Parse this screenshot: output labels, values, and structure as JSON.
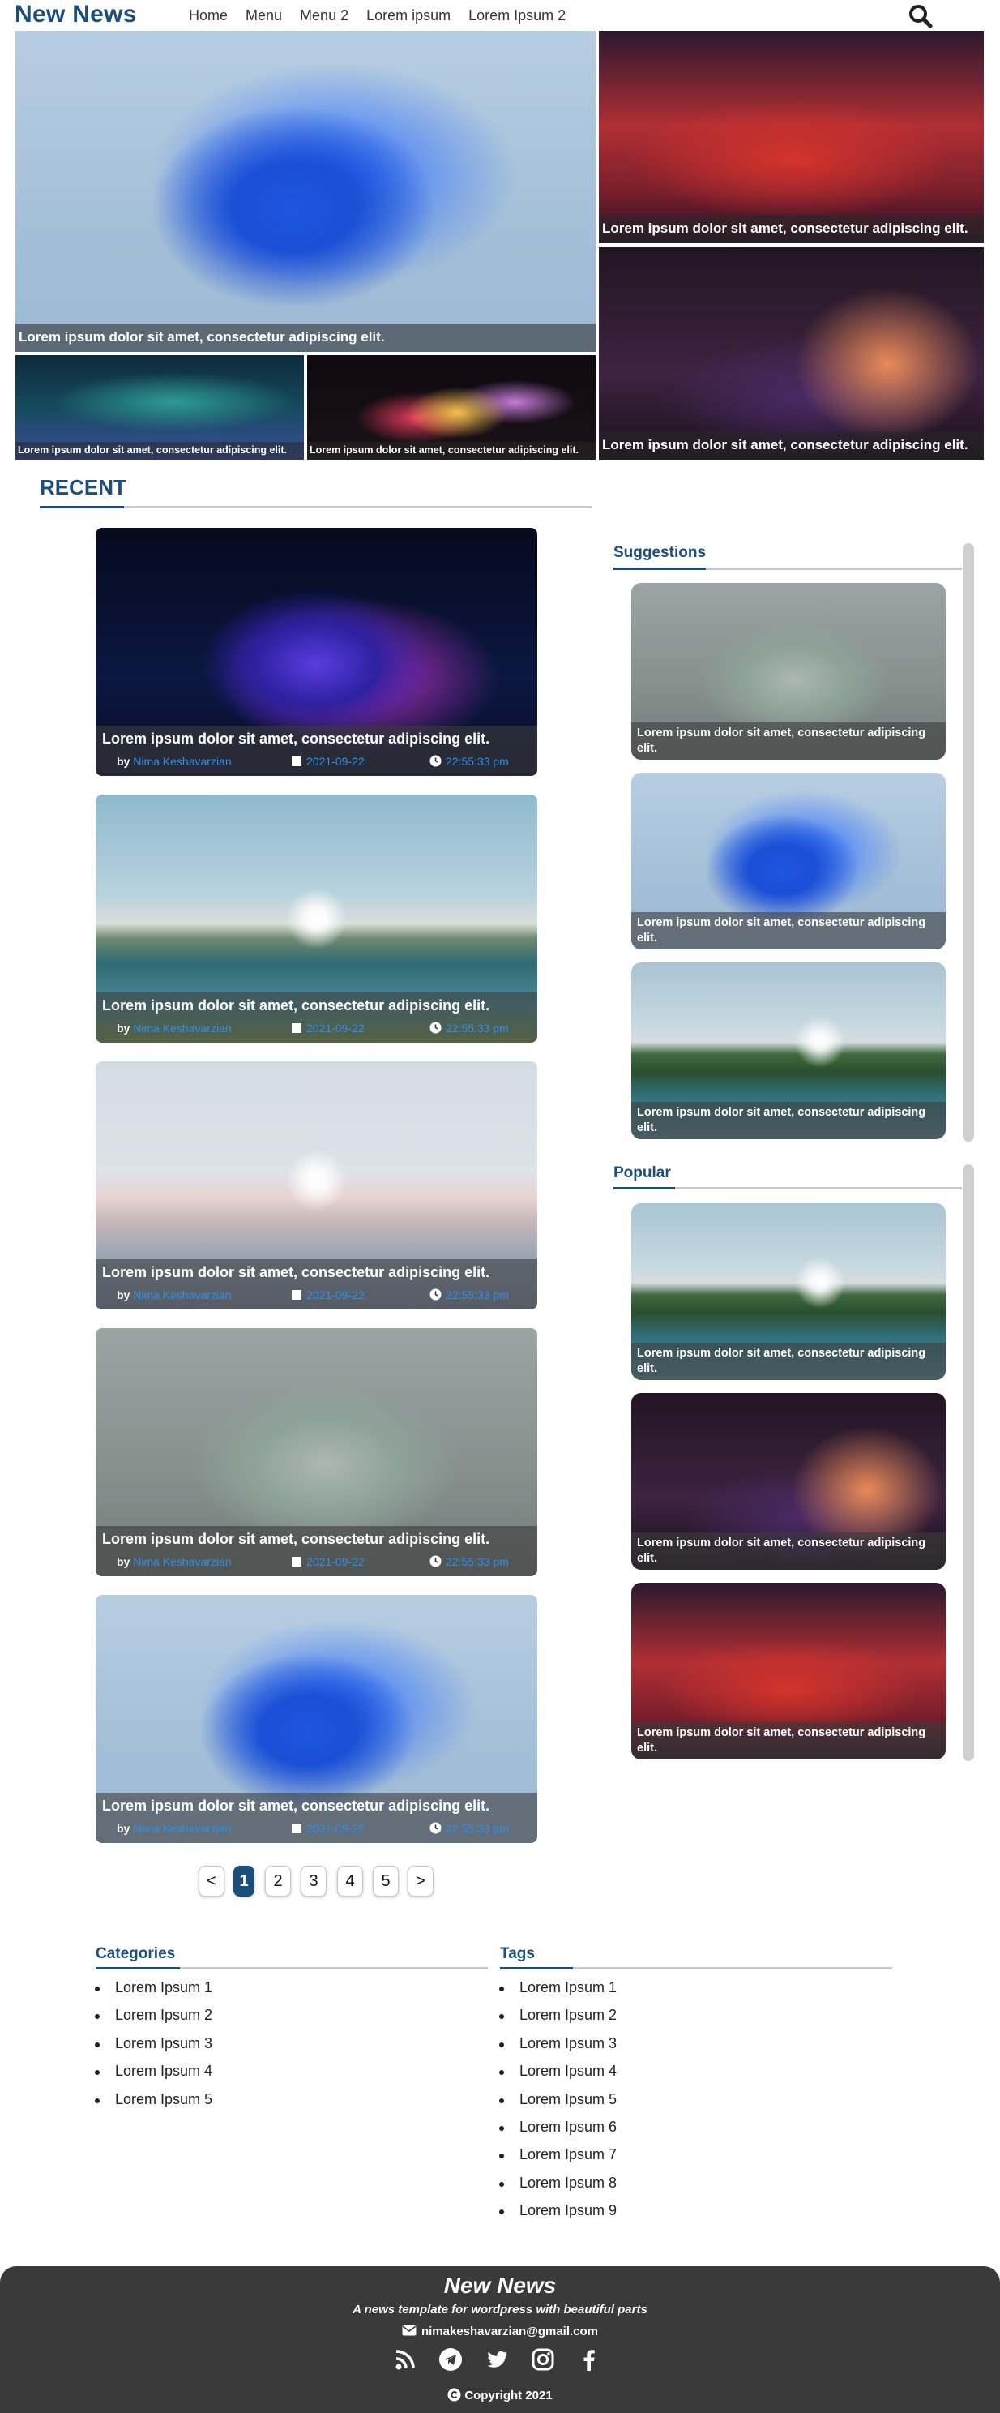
{
  "header": {
    "logo": "New News",
    "nav": [
      "Home",
      "Menu",
      "Menu 2",
      "Lorem ipsum",
      "Lorem Ipsum 2"
    ],
    "search_icon": "search-icon"
  },
  "hero": {
    "main": "Lorem ipsum dolor sit amet, consectetur adipiscing elit.",
    "top_right": "Lorem ipsum dolor sit amet, consectetur adipiscing elit.",
    "bottom_right": "Lorem ipsum dolor sit amet, consectetur adipiscing elit.",
    "small_left": "Lorem ipsum dolor sit amet, consectetur adipiscing elit.",
    "small_right": "Lorem ipsum dolor sit amet, consectetur adipiscing elit."
  },
  "recent": {
    "title": "RECENT",
    "posts": [
      {
        "title": "Lorem ipsum dolor sit amet, consectetur adipiscing elit.",
        "by": "by",
        "author": "Nima Keshavarzian",
        "date": "2021-09-22",
        "time": "22:55:33 pm"
      },
      {
        "title": "Lorem ipsum dolor sit amet, consectetur adipiscing elit.",
        "by": "by",
        "author": "Nima Keshavarzian",
        "date": "2021-09-22",
        "time": "22:55:33 pm"
      },
      {
        "title": "Lorem ipsum dolor sit amet, consectetur adipiscing elit.",
        "by": "by",
        "author": "Nima Keshavarzian",
        "date": "2021-09-22",
        "time": "22:55:33 pm"
      },
      {
        "title": "Lorem ipsum dolor sit amet, consectetur adipiscing elit.",
        "by": "by",
        "author": "Nima Keshavarzian",
        "date": "2021-09-22",
        "time": "22:55:33 pm"
      },
      {
        "title": "Lorem ipsum dolor sit amet, consectetur adipiscing elit.",
        "by": "by",
        "author": "Nima Keshavarzian",
        "date": "2021-09-22",
        "time": "22:55:33 pm"
      }
    ]
  },
  "pagination": {
    "prev": "<",
    "pages": [
      "1",
      "2",
      "3",
      "4",
      "5"
    ],
    "next": ">",
    "active": "1"
  },
  "suggestions": {
    "title": "Suggestions",
    "items": [
      "Lorem ipsum dolor sit amet, consectetur adipiscing elit.",
      "Lorem ipsum dolor sit amet, consectetur adipiscing elit.",
      "Lorem ipsum dolor sit amet, consectetur adipiscing elit."
    ]
  },
  "popular": {
    "title": "Popular",
    "items": [
      "Lorem ipsum dolor sit amet, consectetur adipiscing elit.",
      "Lorem ipsum dolor sit amet, consectetur adipiscing elit.",
      "Lorem ipsum dolor sit amet, consectetur adipiscing elit."
    ]
  },
  "categories": {
    "title": "Categories",
    "items": [
      "Lorem Ipsum 1",
      "Lorem Ipsum 2",
      "Lorem Ipsum 3",
      "Lorem Ipsum 4",
      "Lorem Ipsum 5"
    ]
  },
  "tags": {
    "title": "Tags",
    "items": [
      "Lorem Ipsum 1",
      "Lorem Ipsum 2",
      "Lorem Ipsum 3",
      "Lorem Ipsum 4",
      "Lorem Ipsum 5",
      "Lorem Ipsum 6",
      "Lorem Ipsum 7",
      "Lorem Ipsum 8",
      "Lorem Ipsum 9"
    ]
  },
  "footer": {
    "title": "New News",
    "tagline": "A news template for wordpress with beautiful parts",
    "email": "nimakeshavarzian@gmail.com",
    "social": [
      "rss-icon",
      "telegram-icon",
      "twitter-icon",
      "instagram-icon",
      "facebook-icon"
    ],
    "copyright": "Copyright 2021"
  },
  "colors": {
    "brand": "#1d4e7a",
    "link": "#2f8fe8",
    "footer_bg": "#3a3a3a"
  }
}
